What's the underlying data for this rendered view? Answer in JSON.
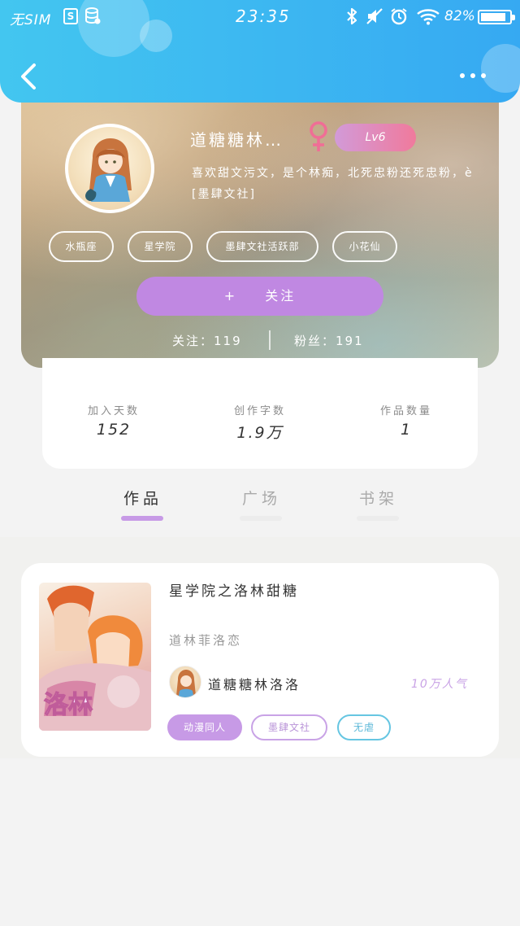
{
  "status_bar": {
    "sim": "无SIM",
    "s_badge": "S",
    "time": "23:35",
    "battery": "82%"
  },
  "nav": {
    "back_icon": "chevron-left-icon",
    "more_icon": "more-dots-icon"
  },
  "profile": {
    "nickname": "道糖糖林…",
    "gender_icon": "female-icon",
    "level": "Lv6",
    "bio_line1": "喜欢甜文污文，是个林痴，北死忠粉还死忠粉，è",
    "bio_line2": "[墨肆文社]",
    "tags": [
      "水瓶座",
      "星学院",
      "墨肆文社活跃部",
      "小花仙"
    ],
    "follow_plus": "+",
    "follow_label": "关注",
    "following_count": "关注：119",
    "fans_count": "粉丝：191"
  },
  "stats": [
    {
      "label": "加入天数",
      "value": "152"
    },
    {
      "label": "创作字数",
      "value": "1.9万"
    },
    {
      "label": "作品数量",
      "value": "1"
    }
  ],
  "tabs": [
    {
      "label": "作品",
      "active": true
    },
    {
      "label": "广场",
      "active": false
    },
    {
      "label": "书架",
      "active": false
    }
  ],
  "work": {
    "title": "星学院之洛林甜糖",
    "subtitle": "道林菲洛恋",
    "author": "道糖糖林洛洛",
    "popularity": "10万人气",
    "tags": [
      "动漫同人",
      "墨肆文社",
      "无虐"
    ]
  },
  "colors": {
    "header": "#3fb8f1",
    "accent_purple": "#c088e2",
    "tag_blue": "#66c6e2",
    "badge_pink": "#f07a9c"
  }
}
